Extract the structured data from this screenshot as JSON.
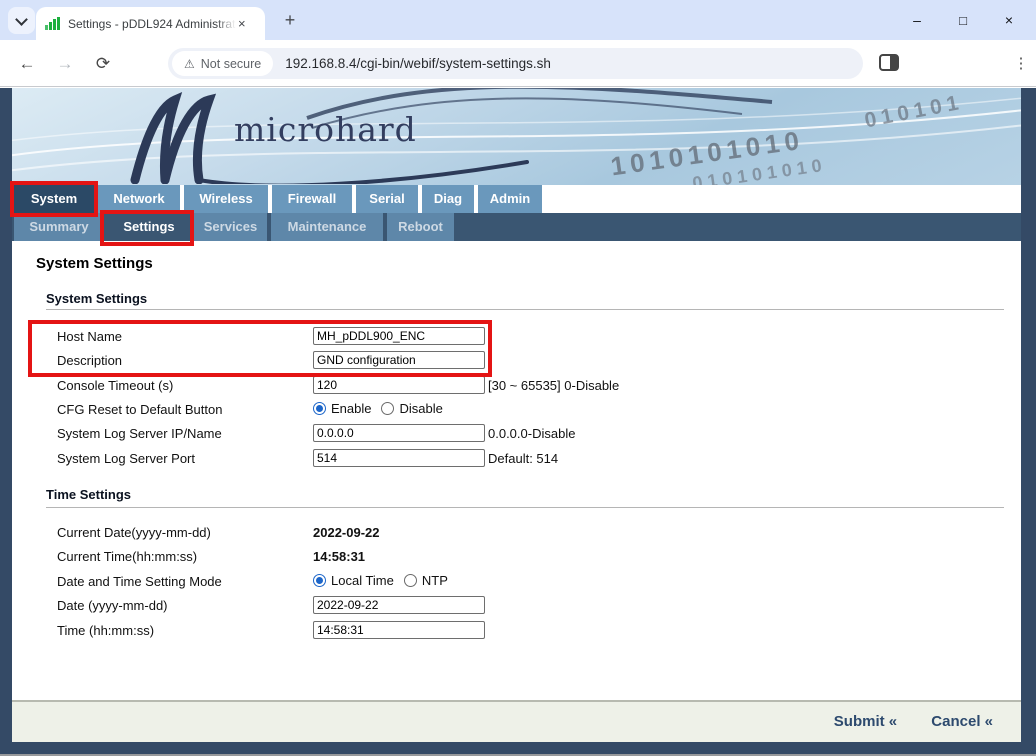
{
  "browser": {
    "window_controls": {
      "minimize": "–",
      "maximize": "□",
      "close": "×"
    },
    "tab_strip": {
      "tab_title": "Settings - pDDL924 Administrat",
      "tab_close_icon": "×",
      "new_tab_icon": "+"
    },
    "toolbar": {
      "back_icon": "←",
      "forward_icon": "→",
      "reload_icon": "⟳",
      "menu_icon": "⋮",
      "address": {
        "warning_icon": "⚠",
        "security_label": "Not secure",
        "url": "192.168.8.4/cgi-bin/webif/system-settings.sh"
      }
    }
  },
  "brand": {
    "logo_text": "microhard",
    "binary_line_1": "1010101010",
    "binary_line_2": "010101010",
    "binary_line_3": "010101"
  },
  "nav": {
    "tabs": [
      {
        "label": "System",
        "active": true
      },
      {
        "label": "Network",
        "active": false
      },
      {
        "label": "Wireless",
        "active": false
      },
      {
        "label": "Firewall",
        "active": false
      },
      {
        "label": "Serial",
        "active": false
      },
      {
        "label": "Diag",
        "active": false
      },
      {
        "label": "Admin",
        "active": false
      }
    ]
  },
  "subnav": {
    "tabs": [
      {
        "label": "Summary",
        "active": false
      },
      {
        "label": "Settings",
        "active": true
      },
      {
        "label": "Services",
        "active": false
      },
      {
        "label": "Maintenance",
        "active": false
      },
      {
        "label": "Reboot",
        "active": false
      }
    ]
  },
  "page": {
    "title": "System Settings",
    "system_section": {
      "heading": "System Settings",
      "rows": [
        {
          "label": "Host Name",
          "value": "MH_pDDL900_ENC"
        },
        {
          "label": "Description",
          "value": "GND configuration"
        },
        {
          "label": "Console Timeout (s)",
          "value": "120",
          "hint": "[30 ~ 65535] 0-Disable"
        },
        {
          "label": "CFG Reset to Default Button",
          "options": [
            {
              "label": "Enable",
              "selected": true
            },
            {
              "label": "Disable",
              "selected": false
            }
          ]
        },
        {
          "label": "System Log Server IP/Name",
          "value": "0.0.0.0",
          "hint": "0.0.0.0-Disable"
        },
        {
          "label": "System Log Server Port",
          "value": "514",
          "hint": "Default: 514"
        }
      ]
    },
    "time_section": {
      "heading": "Time Settings",
      "rows": [
        {
          "label": "Current Date(yyyy-mm-dd)",
          "value": "2022-09-22"
        },
        {
          "label": "Current Time(hh:mm:ss)",
          "value": "14:58:31"
        },
        {
          "label": "Date and Time Setting Mode",
          "options": [
            {
              "label": "Local Time",
              "selected": true
            },
            {
              "label": "NTP",
              "selected": false
            }
          ]
        },
        {
          "label": "Date (yyyy-mm-dd)",
          "value": "2022-09-22"
        },
        {
          "label": "Time (hh:mm:ss)",
          "value": "14:58:31"
        }
      ]
    },
    "footer": {
      "submit_label": "Submit «",
      "cancel_label": "Cancel «"
    }
  },
  "annotations": {
    "description": "red highlight boxes",
    "targets": [
      "system-tab",
      "settings-subtab",
      "hostname-description-rows"
    ]
  },
  "colors": {
    "titlebar_bg": "#d7e3fa",
    "url_pill_bg": "#eef1f8",
    "navy_frame": "#344a66",
    "tab_inactive": "#6a98bc",
    "tab_active": "#2b4966",
    "subtab_bar": "#3a5672",
    "subtab_inactive": "#5e87a9",
    "footer_bg": "#eef1e8",
    "link_navy": "#2d4a6e",
    "annotation_red": "#e41414",
    "radio_blue": "#1d66c9",
    "favicon_green": "#1caf3e"
  }
}
